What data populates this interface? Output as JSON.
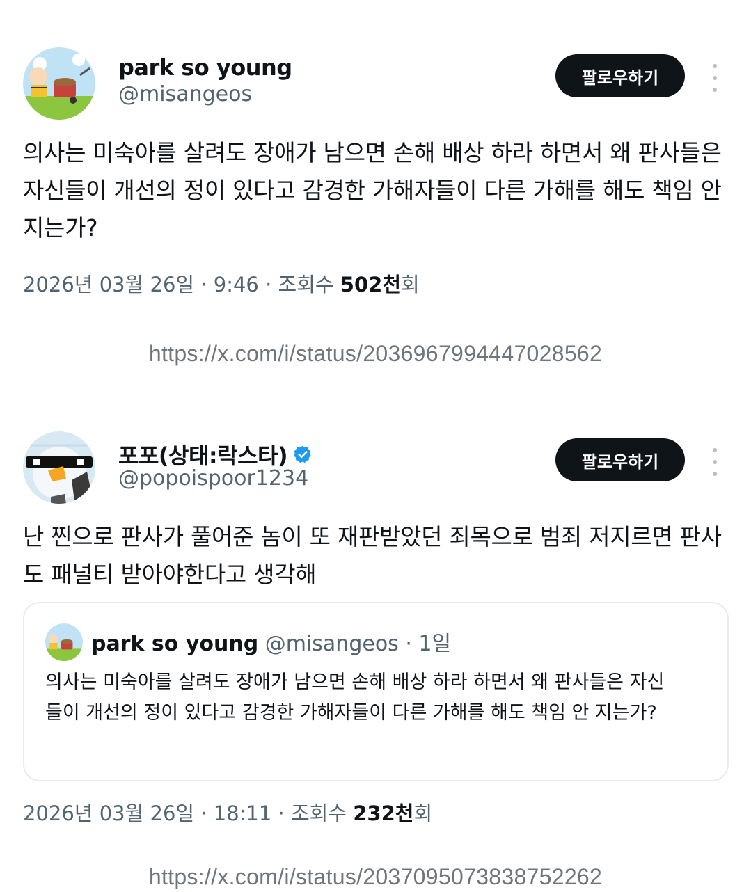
{
  "tweets": [
    {
      "name": "park so young",
      "handle": "@misangeos",
      "follow_label": "팔로우하기",
      "text": "의사는 미숙아를 살려도 장애가 남으면 손해 배상 하라 하면서 왜 판사들은 자신들이 개선의 정이 있다고 감경한 가해자들이 다른 가해를 해도 책임 안 지는가?",
      "meta_prefix": "2026년 03월 26일 · 9:46 · 조회수 ",
      "views": "502천",
      "views_suffix": "회",
      "url": "https://x.com/i/status/2036967994447028562"
    },
    {
      "name": "포포(상태:락스타)",
      "handle": "@popoispoor1234",
      "verified": true,
      "follow_label": "팔로우하기",
      "text": "난 찐으로 판사가 풀어준 놈이 또 재판받았던 죄목으로 범죄 저지르면 판사도 패널티 받아야한다고 생각해",
      "quote": {
        "name": "park so young",
        "handle": "@misangeos",
        "time": "· 1일",
        "text": "의사는 미숙아를 살려도 장애가 남으면 손해 배상 하라 하면서 왜 판사들은 자신들이 개선의 정이 있다고 감경한 가해자들이 다른 가해를 해도 책임 안 지는가?"
      },
      "meta_prefix": "2026년 03월 26일 · 18:11 · 조회수 ",
      "views": "232천",
      "views_suffix": "회",
      "url": "https://x.com/i/status/2037095073838752262"
    }
  ],
  "colors": {
    "text": "#0f1419",
    "secondary": "#536471",
    "button": "#0f1419",
    "verified": "#1d9bf0",
    "url": "#6e767d"
  },
  "icons": [
    "more-options-icon",
    "verified-badge-icon"
  ]
}
